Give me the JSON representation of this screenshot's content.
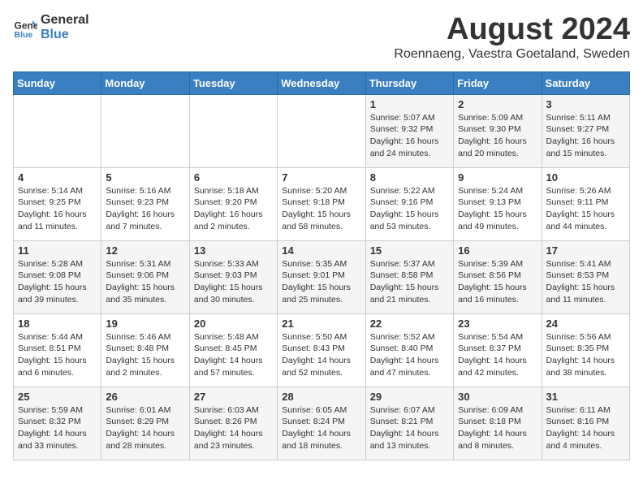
{
  "header": {
    "logo_line1": "General",
    "logo_line2": "Blue",
    "month_title": "August 2024",
    "subtitle": "Roennaeng, Vaestra Goetaland, Sweden"
  },
  "weekdays": [
    "Sunday",
    "Monday",
    "Tuesday",
    "Wednesday",
    "Thursday",
    "Friday",
    "Saturday"
  ],
  "weeks": [
    [
      {
        "day": "",
        "info": ""
      },
      {
        "day": "",
        "info": ""
      },
      {
        "day": "",
        "info": ""
      },
      {
        "day": "",
        "info": ""
      },
      {
        "day": "1",
        "info": "Sunrise: 5:07 AM\nSunset: 9:32 PM\nDaylight: 16 hours\nand 24 minutes."
      },
      {
        "day": "2",
        "info": "Sunrise: 5:09 AM\nSunset: 9:30 PM\nDaylight: 16 hours\nand 20 minutes."
      },
      {
        "day": "3",
        "info": "Sunrise: 5:11 AM\nSunset: 9:27 PM\nDaylight: 16 hours\nand 15 minutes."
      }
    ],
    [
      {
        "day": "4",
        "info": "Sunrise: 5:14 AM\nSunset: 9:25 PM\nDaylight: 16 hours\nand 11 minutes."
      },
      {
        "day": "5",
        "info": "Sunrise: 5:16 AM\nSunset: 9:23 PM\nDaylight: 16 hours\nand 7 minutes."
      },
      {
        "day": "6",
        "info": "Sunrise: 5:18 AM\nSunset: 9:20 PM\nDaylight: 16 hours\nand 2 minutes."
      },
      {
        "day": "7",
        "info": "Sunrise: 5:20 AM\nSunset: 9:18 PM\nDaylight: 15 hours\nand 58 minutes."
      },
      {
        "day": "8",
        "info": "Sunrise: 5:22 AM\nSunset: 9:16 PM\nDaylight: 15 hours\nand 53 minutes."
      },
      {
        "day": "9",
        "info": "Sunrise: 5:24 AM\nSunset: 9:13 PM\nDaylight: 15 hours\nand 49 minutes."
      },
      {
        "day": "10",
        "info": "Sunrise: 5:26 AM\nSunset: 9:11 PM\nDaylight: 15 hours\nand 44 minutes."
      }
    ],
    [
      {
        "day": "11",
        "info": "Sunrise: 5:28 AM\nSunset: 9:08 PM\nDaylight: 15 hours\nand 39 minutes."
      },
      {
        "day": "12",
        "info": "Sunrise: 5:31 AM\nSunset: 9:06 PM\nDaylight: 15 hours\nand 35 minutes."
      },
      {
        "day": "13",
        "info": "Sunrise: 5:33 AM\nSunset: 9:03 PM\nDaylight: 15 hours\nand 30 minutes."
      },
      {
        "day": "14",
        "info": "Sunrise: 5:35 AM\nSunset: 9:01 PM\nDaylight: 15 hours\nand 25 minutes."
      },
      {
        "day": "15",
        "info": "Sunrise: 5:37 AM\nSunset: 8:58 PM\nDaylight: 15 hours\nand 21 minutes."
      },
      {
        "day": "16",
        "info": "Sunrise: 5:39 AM\nSunset: 8:56 PM\nDaylight: 15 hours\nand 16 minutes."
      },
      {
        "day": "17",
        "info": "Sunrise: 5:41 AM\nSunset: 8:53 PM\nDaylight: 15 hours\nand 11 minutes."
      }
    ],
    [
      {
        "day": "18",
        "info": "Sunrise: 5:44 AM\nSunset: 8:51 PM\nDaylight: 15 hours\nand 6 minutes."
      },
      {
        "day": "19",
        "info": "Sunrise: 5:46 AM\nSunset: 8:48 PM\nDaylight: 15 hours\nand 2 minutes."
      },
      {
        "day": "20",
        "info": "Sunrise: 5:48 AM\nSunset: 8:45 PM\nDaylight: 14 hours\nand 57 minutes."
      },
      {
        "day": "21",
        "info": "Sunrise: 5:50 AM\nSunset: 8:43 PM\nDaylight: 14 hours\nand 52 minutes."
      },
      {
        "day": "22",
        "info": "Sunrise: 5:52 AM\nSunset: 8:40 PM\nDaylight: 14 hours\nand 47 minutes."
      },
      {
        "day": "23",
        "info": "Sunrise: 5:54 AM\nSunset: 8:37 PM\nDaylight: 14 hours\nand 42 minutes."
      },
      {
        "day": "24",
        "info": "Sunrise: 5:56 AM\nSunset: 8:35 PM\nDaylight: 14 hours\nand 38 minutes."
      }
    ],
    [
      {
        "day": "25",
        "info": "Sunrise: 5:59 AM\nSunset: 8:32 PM\nDaylight: 14 hours\nand 33 minutes."
      },
      {
        "day": "26",
        "info": "Sunrise: 6:01 AM\nSunset: 8:29 PM\nDaylight: 14 hours\nand 28 minutes."
      },
      {
        "day": "27",
        "info": "Sunrise: 6:03 AM\nSunset: 8:26 PM\nDaylight: 14 hours\nand 23 minutes."
      },
      {
        "day": "28",
        "info": "Sunrise: 6:05 AM\nSunset: 8:24 PM\nDaylight: 14 hours\nand 18 minutes."
      },
      {
        "day": "29",
        "info": "Sunrise: 6:07 AM\nSunset: 8:21 PM\nDaylight: 14 hours\nand 13 minutes."
      },
      {
        "day": "30",
        "info": "Sunrise: 6:09 AM\nSunset: 8:18 PM\nDaylight: 14 hours\nand 8 minutes."
      },
      {
        "day": "31",
        "info": "Sunrise: 6:11 AM\nSunset: 8:16 PM\nDaylight: 14 hours\nand 4 minutes."
      }
    ]
  ]
}
